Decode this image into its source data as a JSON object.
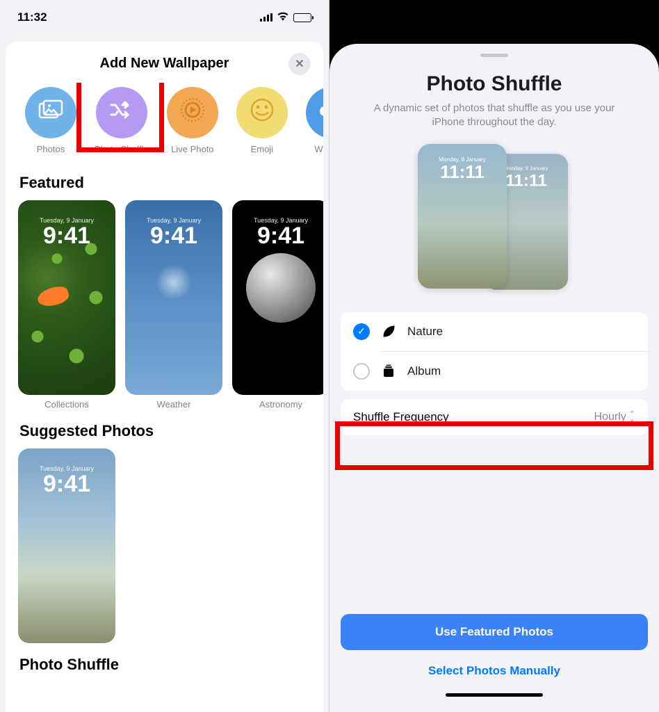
{
  "left": {
    "status": {
      "time": "11:32"
    },
    "sheet_title": "Add New Wallpaper",
    "categories": [
      {
        "label": "Photos",
        "color": "#6fb3e8",
        "icon": "photos"
      },
      {
        "label": "Photo Shuffle",
        "color": "#b49af4",
        "icon": "shuffle"
      },
      {
        "label": "Live Photo",
        "color": "#f2a852",
        "icon": "live"
      },
      {
        "label": "Emoji",
        "color": "#f3db73",
        "icon": "emoji"
      },
      {
        "label": "Weather",
        "color": "#4f9ce8",
        "icon": "cloud"
      }
    ],
    "sections": {
      "featured": "Featured",
      "suggested": "Suggested Photos",
      "photo_shuffle": "Photo Shuffle"
    },
    "featured": [
      {
        "label": "Collections",
        "clock": "9:41",
        "date": "Tuesday, 9 January"
      },
      {
        "label": "Weather",
        "clock": "9:41",
        "date": "Tuesday, 9 January"
      },
      {
        "label": "Astronomy",
        "clock": "9:41",
        "date": "Tuesday, 9 January"
      }
    ],
    "suggested": [
      {
        "clock": "9:41",
        "date": "Tuesday, 9 January"
      }
    ]
  },
  "right": {
    "title": "Photo Shuffle",
    "subtitle": "A dynamic set of photos that shuffle as you use your iPhone throughout the day.",
    "preview": {
      "clock": "11:11",
      "date": "Monday, 8 January"
    },
    "options": [
      {
        "label": "Nature",
        "selected": true,
        "icon": "leaf"
      },
      {
        "label": "Album",
        "selected": false,
        "icon": "album"
      }
    ],
    "frequency": {
      "label": "Shuffle Frequency",
      "value": "Hourly"
    },
    "primary_button": "Use Featured Photos",
    "link_button": "Select Photos Manually"
  }
}
